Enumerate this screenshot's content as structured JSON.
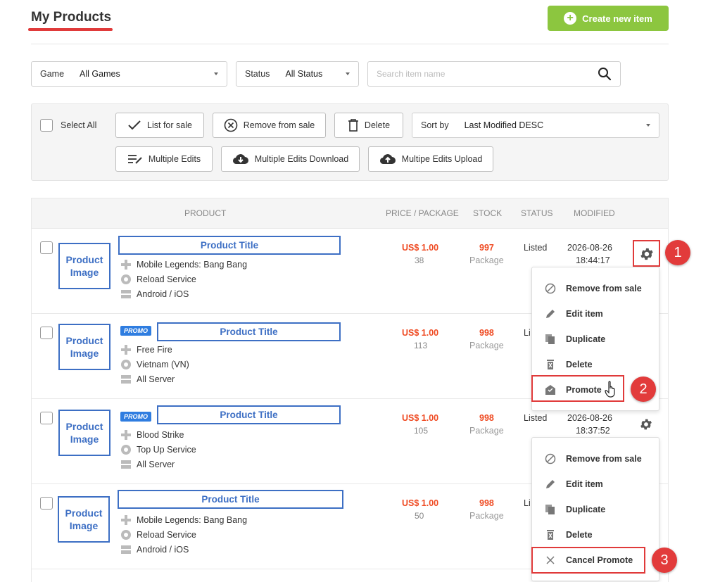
{
  "header": {
    "title": "My Products",
    "create_label": "Create new item"
  },
  "filters": {
    "game_label": "Game",
    "game_value": "All Games",
    "status_label": "Status",
    "status_value": "All Status",
    "search_placeholder": "Search item name"
  },
  "toolbar": {
    "select_all": "Select All",
    "list_for_sale": "List for sale",
    "remove_from_sale": "Remove from sale",
    "delete": "Delete",
    "sort_label": "Sort by",
    "sort_value": "Last Modified DESC",
    "multiple_edits": "Multiple Edits",
    "multiple_edits_download": "Multiple Edits Download",
    "multiple_edits_upload": "Multipe Edits Upload"
  },
  "table": {
    "headers": {
      "product": "PRODUCT",
      "price": "PRICE / PACKAGE",
      "stock": "STOCK",
      "status": "STATUS",
      "modified": "MODIFIED"
    },
    "rows": [
      {
        "image": "Product Image",
        "title": "Product Title",
        "promo": "",
        "game": "Mobile Legends: Bang Bang",
        "service": "Reload Service",
        "server": "Android / iOS",
        "price": "US$ 1.00",
        "package": "38",
        "stock": "997",
        "stock_unit": "Package",
        "status": "Listed",
        "modified_date": "2026-08-26",
        "modified_time": "18:44:17"
      },
      {
        "image": "Product Image",
        "title": "Product Title",
        "promo": "PROMO",
        "game": "Free Fire",
        "service": "Vietnam (VN)",
        "server": "All Server",
        "price": "US$ 1.00",
        "package": "113",
        "stock": "998",
        "stock_unit": "Package",
        "status": "Li"
      },
      {
        "image": "Product Image",
        "title": "Product Title",
        "promo": "PROMO",
        "game": "Blood Strike",
        "service": "Top Up Service",
        "server": "All Server",
        "price": "US$ 1.00",
        "package": "105",
        "stock": "998",
        "stock_unit": "Package",
        "status": "Listed",
        "modified_date": "2026-08-26",
        "modified_time": "18:37:52"
      },
      {
        "image": "Product Image",
        "title": "Product Title",
        "promo": "",
        "game": "Mobile Legends: Bang Bang",
        "service": "Reload Service",
        "server": "Android / iOS",
        "price": "US$ 1.00",
        "package": "50",
        "stock": "998",
        "stock_unit": "Package",
        "status": "Li"
      }
    ]
  },
  "menu1": {
    "items": [
      "Remove from sale",
      "Edit item",
      "Duplicate",
      "Delete",
      "Promote"
    ]
  },
  "menu2": {
    "items": [
      "Remove from sale",
      "Edit item",
      "Duplicate",
      "Delete",
      "Cancel Promote"
    ]
  },
  "steps": [
    "1",
    "2",
    "3"
  ],
  "colors": {
    "accent_green": "#8cc63f",
    "price_red": "#ef4b23",
    "annotation_red": "#e23b3b",
    "placeholder_blue": "#3d6fc4",
    "promo_blue": "#2f7de0"
  },
  "icons": {
    "search": "search-icon",
    "gear": "gear-icon",
    "checkmark": "checkmark-icon",
    "remove": "circle-x-icon",
    "trash": "trash-icon",
    "edit_lines": "edit-lines-icon",
    "cloud_download": "cloud-download-icon",
    "cloud_upload": "cloud-upload-icon",
    "gamepad": "gamepad-icon",
    "service": "service-icon",
    "server": "server-icon",
    "ban": "ban-icon",
    "pencil": "pencil-icon",
    "copy": "copy-icon",
    "promote": "promote-icon",
    "close": "close-icon",
    "cursor": "hand-cursor-icon"
  }
}
